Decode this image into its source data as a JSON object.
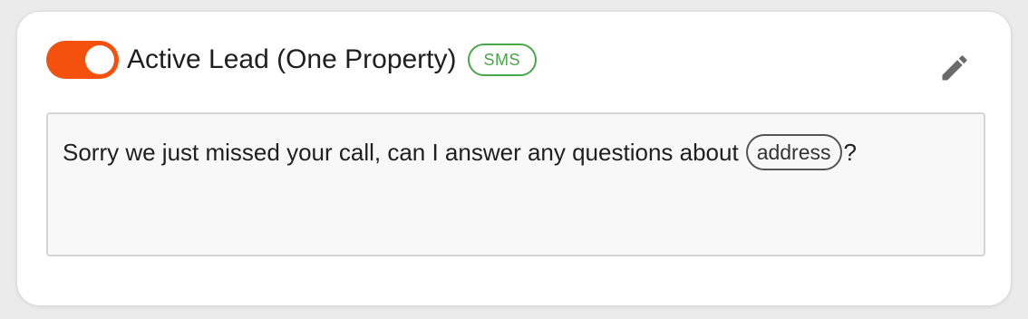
{
  "template": {
    "title": "Active Lead (One Property)",
    "channel_badge": "SMS",
    "enabled": true,
    "message": {
      "text_before": "Sorry we just missed your call, can I answer any questions about",
      "variable": "address",
      "text_after": "?"
    }
  },
  "icons": {
    "edit": "pencil-icon"
  },
  "colors": {
    "toggle_on": "#f4510f",
    "badge_green": "#4aa64a",
    "icon_gray": "#6b6b6b"
  }
}
